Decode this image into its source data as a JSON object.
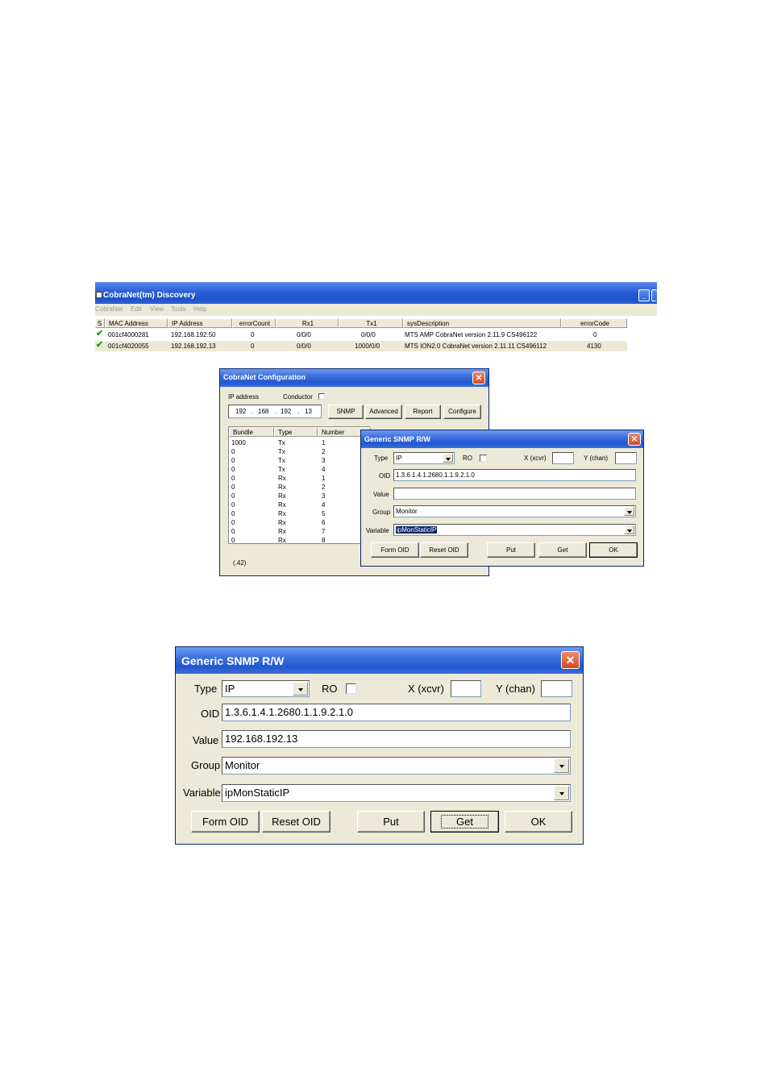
{
  "discovery": {
    "title": "CobraNet(tm) Discovery",
    "menu": [
      "CobraNet",
      "Edit",
      "View",
      "Tools",
      "Help"
    ],
    "columns": [
      "S",
      "MAC Address",
      "IP Address",
      "errorCount",
      "Rx1",
      "Tx1",
      "sysDescription",
      "errorCode"
    ],
    "rows": [
      {
        "mac": "001cf4000281",
        "ip": "192.168.192.50",
        "errorCount": "0",
        "rx1": "0/0/0",
        "tx1": "0/0/0",
        "sysDescription": "MTS AMP CobraNet version 2.11.9 CS496122",
        "errorCode": "0"
      },
      {
        "mac": "001cf4020055",
        "ip": "192.168.192.13",
        "errorCount": "0",
        "rx1": "0/0/0",
        "tx1": "1000/0/0",
        "sysDescription": "MTS ION2.0 CobraNet version 2.11.11 CS496112",
        "errorCode": "4130"
      }
    ],
    "minimize_label": "_",
    "status_icon": "green-check-icon"
  },
  "config": {
    "title": "CobraNet Configuration",
    "ip_label": "IP address",
    "conductor_label": "Conductor",
    "ip": [
      "192",
      "168",
      "192",
      "13"
    ],
    "buttons": [
      "SNMP",
      "Advanced",
      "Report",
      "Configure"
    ],
    "columns": [
      "Bundle",
      "Type",
      "Number"
    ],
    "rows": [
      [
        "1000",
        "Tx",
        "1"
      ],
      [
        "0",
        "Tx",
        "2"
      ],
      [
        "0",
        "Tx",
        "3"
      ],
      [
        "0",
        "Tx",
        "4"
      ],
      [
        "0",
        "Rx",
        "1"
      ],
      [
        "0",
        "Rx",
        "2"
      ],
      [
        "0",
        "Rx",
        "3"
      ],
      [
        "0",
        "Rx",
        "4"
      ],
      [
        "0",
        "Rx",
        "5"
      ],
      [
        "0",
        "Rx",
        "6"
      ],
      [
        "0",
        "Rx",
        "7"
      ],
      [
        "0",
        "Rx",
        "8"
      ]
    ],
    "footer": "(.42)"
  },
  "snmp_small": {
    "title": "Generic SNMP R/W",
    "type_label": "Type",
    "type_value": "IP",
    "ro_label": "RO",
    "x_label": "X (xcvr)",
    "y_label": "Y (chan)",
    "oid_label": "OID",
    "oid_value": "1.3.6.1.4.1.2680.1.1.9.2.1.0",
    "value_label": "Value",
    "value_value": "",
    "group_label": "Group",
    "group_value": "Monitor",
    "variable_label": "Variable",
    "variable_value": "ipMonStaticIP",
    "buttons": {
      "form_oid": "Form OID",
      "reset_oid": "Reset OID",
      "put": "Put",
      "get": "Get",
      "ok": "OK"
    }
  },
  "snmp_large": {
    "title": "Generic SNMP R/W",
    "type_label": "Type",
    "type_value": "IP",
    "ro_label": "RO",
    "x_label": "X (xcvr)",
    "y_label": "Y (chan)",
    "oid_label": "OID",
    "oid_value": "1.3.6.1.4.1.2680.1.1.9.2.1.0",
    "value_label": "Value",
    "value_value": "192.168.192.13",
    "group_label": "Group",
    "group_value": "Monitor",
    "variable_label": "Variable",
    "variable_value": "ipMonStaticIP",
    "buttons": {
      "form_oid": "Form OID",
      "reset_oid": "Reset OID",
      "put": "Put",
      "get": "Get",
      "ok": "OK"
    }
  },
  "colors": {
    "titlebar": "#2458d2",
    "dialog_bg": "#ece9d8",
    "selection": "#0a246a",
    "close": "#d14a24"
  }
}
